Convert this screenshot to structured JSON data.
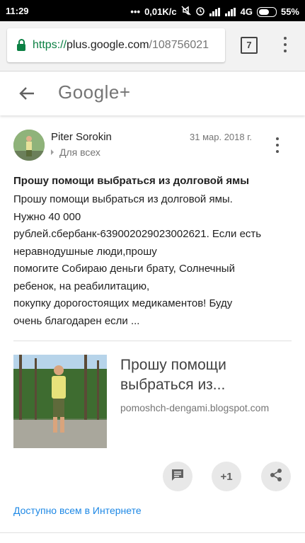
{
  "status_bar": {
    "time": "11:29",
    "net_speed": "0,01K/c",
    "network": "4G",
    "battery": "55%"
  },
  "browser": {
    "url_scheme": "https://",
    "url_host": "plus.google.com",
    "url_path": "/108756021",
    "tab_count": "7"
  },
  "app_header": {
    "logo_text": "Google+"
  },
  "post": {
    "author": "Piter Sorokin",
    "audience": "Для всех",
    "date": "31 мар. 2018 г.",
    "title": "Прошу помощи выбраться из долговой ямы",
    "body": "Прошу помощи выбраться из долговой ямы.\nНужно 40 000\nрублей.сбербанк-639002029023002621. Если есть\nнеравнодушные люди,прошу\nпомогите Собираю деньги брату, Солнечный\nребенок, на реабилитацию,\nпокупку дорогостоящих медикаментов! Буду\nочень благодарен если ..."
  },
  "link_preview": {
    "title": "Прошу помощи выбраться из...",
    "domain": "pomoshch-dengami.blogspot.com"
  },
  "actions": {
    "plus_one": "+1"
  },
  "visibility": "Доступно всем в Интернете",
  "colors": {
    "link_blue": "#1e88e5",
    "secure_green": "#0b8043"
  }
}
